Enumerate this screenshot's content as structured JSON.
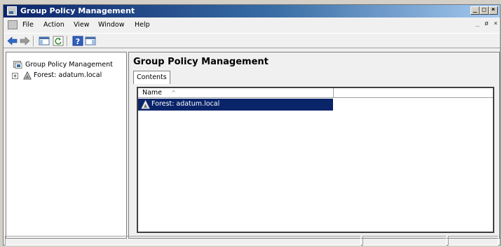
{
  "window": {
    "title": "Group Policy Management",
    "controls": [
      "minimize",
      "restore",
      "close"
    ]
  },
  "menubar": {
    "items": [
      "File",
      "Action",
      "View",
      "Window",
      "Help"
    ],
    "mdi_controls": [
      "minimize",
      "restore",
      "close"
    ]
  },
  "toolbar": {
    "buttons": [
      "back-icon",
      "forward-icon",
      "show-hide-console-tree-icon",
      "refresh-icon",
      "help-icon",
      "show-hide-action-pane-icon"
    ]
  },
  "tree": {
    "root": "Group Policy Management",
    "children": [
      {
        "label": "Forest: adatum.local",
        "expander": "+"
      }
    ]
  },
  "content": {
    "title": "Group Policy Management",
    "tabs": [
      "Contents"
    ],
    "list": {
      "columns": [
        "Name"
      ],
      "sort_indicator": "^",
      "rows": [
        {
          "name": "Forest: adatum.local",
          "selected": true
        }
      ]
    }
  },
  "colors": {
    "selection": "#0a246a",
    "titlebar_start": "#0a246a",
    "titlebar_end": "#a6caf0"
  }
}
